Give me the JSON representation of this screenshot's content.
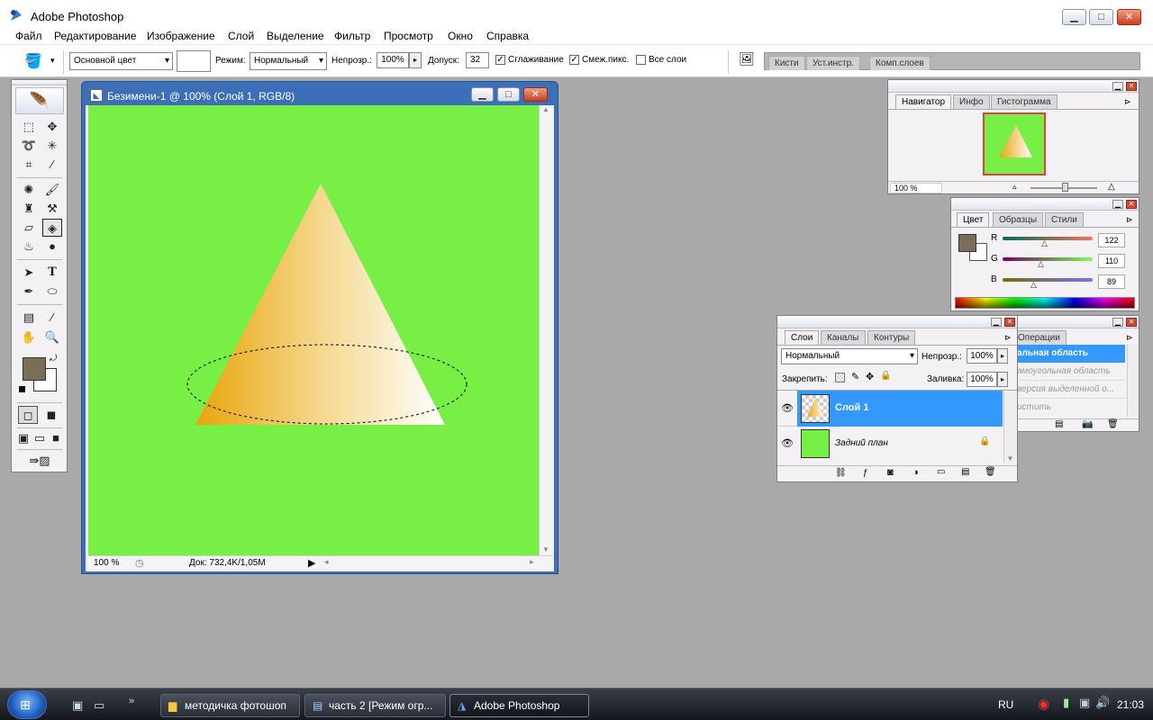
{
  "window": {
    "title": "Adobe Photoshop",
    "min_label": "▁",
    "max_label": "□",
    "close_label": "✕"
  },
  "menu": [
    "Файл",
    "Редактирование",
    "Изображение",
    "Слой",
    "Выделение",
    "Фильтр",
    "Просмотр",
    "Окно",
    "Справка"
  ],
  "options": {
    "fill_source": "Основной цвет",
    "mode_label": "Режим:",
    "mode_value": "Нормальный",
    "opacity_label": "Непрозр.:",
    "opacity_value": "100%",
    "tolerance_label": "Допуск:",
    "tolerance_value": "32",
    "antialias_label": "Сглаживание",
    "antialias_checked": true,
    "contiguous_label": "Смеж.пикс.",
    "contiguous_checked": true,
    "all_layers_label": "Все слои",
    "all_layers_checked": false
  },
  "well_tabs": [
    "Кисти",
    "Уст.инстр.",
    "Комп.слоев"
  ],
  "document": {
    "title": "Безимени-1 @ 100% (Слой 1, RGB/8)",
    "zoom": "100 %",
    "doc_info": "Док: 732,4K/1,05M"
  },
  "colors": {
    "foreground": "#7a6e59",
    "canvas": "#77ef45",
    "accent": "#3399ff"
  },
  "navigator": {
    "tabs": [
      "Навигатор",
      "Инфо",
      "Гистограмма"
    ],
    "zoom": "100 %"
  },
  "color_palette": {
    "tabs": [
      "Цвет",
      "Образцы",
      "Стили"
    ],
    "r_label": "R",
    "g_label": "G",
    "b_label": "B",
    "r": "122",
    "g": "110",
    "b": "89"
  },
  "history": {
    "tab": "Операции",
    "items": [
      "альная область",
      "амоугольная область",
      "версия выделенной о...",
      "истить"
    ]
  },
  "layers": {
    "tabs": [
      "Слои",
      "Каналы",
      "Контуры"
    ],
    "blend_mode": "Нормальный",
    "opacity_label": "Непрозр.:",
    "opacity": "100%",
    "lock_label": "Закрепить:",
    "fill_label": "Заливка:",
    "fill": "100%",
    "items": [
      {
        "name": "Слой 1",
        "selected": true
      },
      {
        "name": "Задний план",
        "selected": false
      }
    ]
  },
  "taskbar": {
    "buttons": [
      "методичка фотошоп",
      "часть 2 [Режим огр...",
      "Adobe Photoshop"
    ],
    "lang": "RU",
    "clock": "21:03"
  }
}
